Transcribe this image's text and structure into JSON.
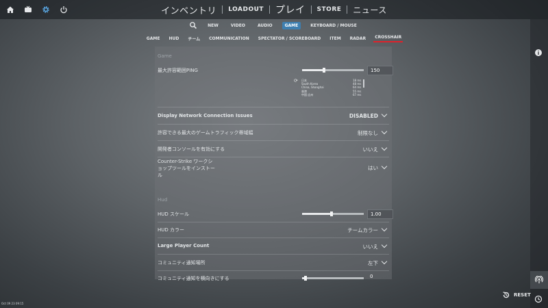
{
  "topbar": {
    "icons": [
      "home-icon",
      "tv-icon",
      "gear-icon",
      "power-icon"
    ],
    "nav": {
      "inventory": "インベントリ",
      "loadout": "LOADOUT",
      "play": "プレイ",
      "store": "STORE",
      "news": "ニュース"
    }
  },
  "settings_tabs": [
    "NEW",
    "VIDEO",
    "AUDIO",
    "GAME",
    "KEYBOARD / MOUSE"
  ],
  "settings_tabs_active": "GAME",
  "game_tabs": [
    "GAME",
    "HUD",
    "チーム",
    "COMMUNICATION",
    "SPECTATOR / SCOREBOARD",
    "ITEM",
    "RADAR",
    "CROSSHAIR"
  ],
  "game_tabs_active": "CROSSHAIR",
  "sections": {
    "game": "Game",
    "hud": "Hud"
  },
  "ping": {
    "label": "最大許容範囲PING",
    "value": "150",
    "slider_fraction": 0.36,
    "regions": [
      "日本",
      "South Korea",
      "China, Shanghai",
      "香港",
      "中国 広州"
    ],
    "ms": [
      "18 ms",
      "48 ms",
      "64 ms",
      "55 ms",
      "67 ms"
    ]
  },
  "rows": [
    {
      "label": "Display Network Connection Issues",
      "value": "DISABLED",
      "bold": true
    },
    {
      "label": "許容できる最大のゲームトラフィック帯域幅",
      "value": "制限なし",
      "bold": false
    },
    {
      "label": "開発者コンソールを有効にする",
      "value": "いいえ",
      "bold": false
    },
    {
      "label_lines": [
        "Counter-Strike ワークシ",
        "ョップツールをインストー",
        "ル"
      ],
      "value": "はい",
      "bold": false
    }
  ],
  "hud_scale": {
    "label": "HUD スケール",
    "value": "1.00",
    "slider_fraction": 0.48
  },
  "hud_rows": [
    {
      "label": "HUD カラー",
      "value": "チームカラー",
      "bold": false
    },
    {
      "label": "Large Player Count",
      "value": "いいえ",
      "bold": true
    },
    {
      "label": "コミュニティ通知場所",
      "value": "左下",
      "bold": false
    }
  ],
  "notify_offset": {
    "label": "コミュニティ通知を横向きにする",
    "value": "0",
    "slider_fraction": 0.05
  },
  "reset_label": "RESET",
  "version": "Oct 09 23 09:15"
}
